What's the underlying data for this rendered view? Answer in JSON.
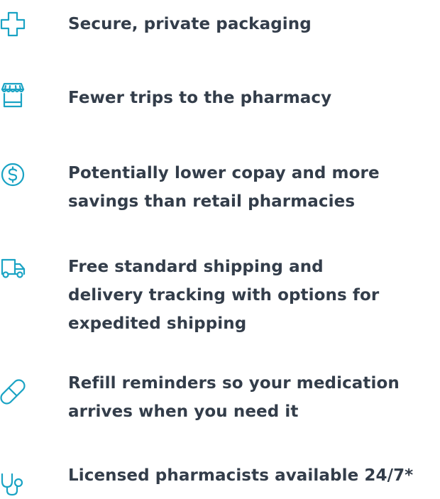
{
  "colors": {
    "icon": "#1aa3c4",
    "text": "#333d4a"
  },
  "features": [
    {
      "icon": "medical-cross-icon",
      "text": "Secure, private packaging"
    },
    {
      "icon": "storefront-icon",
      "text": "Fewer trips to the pharmacy"
    },
    {
      "icon": "dollar-coin-icon",
      "text": "Potentially lower copay and more\nsavings than retail pharmacies"
    },
    {
      "icon": "delivery-truck-icon",
      "text": "Free standard shipping and\ndelivery tracking with options for\nexpedited shipping"
    },
    {
      "icon": "pill-capsule-icon",
      "text": "Refill reminders so your medication\narrives when you need it"
    },
    {
      "icon": "stethoscope-icon",
      "text": "Licensed pharmacists available 24/7*"
    }
  ]
}
